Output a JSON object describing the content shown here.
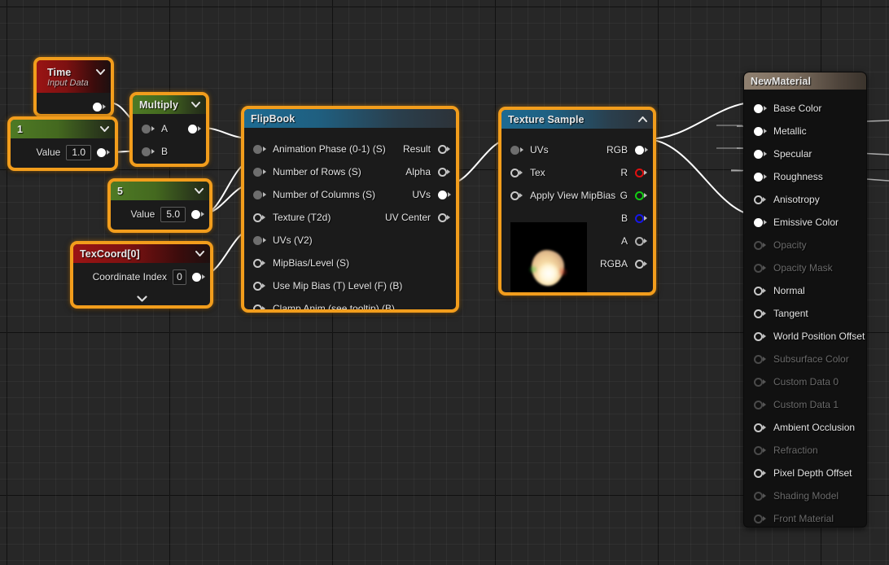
{
  "app": {
    "editor": "Unreal Material Graph"
  },
  "nodes": {
    "time": {
      "title": "Time",
      "subtitle": "Input Data",
      "out_pin": "output"
    },
    "const1": {
      "title": "1",
      "value_label": "Value",
      "value": "1.0"
    },
    "multiply": {
      "title": "Multiply",
      "inputs": [
        "A",
        "B"
      ],
      "output": ""
    },
    "const5": {
      "title": "5",
      "value_label": "Value",
      "value": "5.0"
    },
    "texcoord": {
      "title": "TexCoord[0]",
      "value_label": "Coordinate Index",
      "value": "0"
    },
    "flipbook": {
      "title": "FlipBook",
      "inputs": [
        "Animation  Phase (0-1) (S)",
        "Number of Rows (S)",
        "Number of Columns (S)",
        "Texture (T2d)",
        "UVs (V2)",
        "MipBias/Level (S)",
        "Use Mip Bias (T) Level (F) (B)",
        "Clamp Anim (see tooltip) (B)"
      ],
      "outputs": [
        "Result",
        "Alpha",
        "UVs",
        "UV Center"
      ]
    },
    "texturesample": {
      "title": "Texture Sample",
      "inputs": [
        "UVs",
        "Tex",
        "Apply View MipBias"
      ],
      "outputs": [
        "RGB",
        "R",
        "G",
        "B",
        "A",
        "RGBA"
      ]
    },
    "material": {
      "title": "NewMaterial",
      "inputs": [
        {
          "label": "Base Color",
          "state": "connected"
        },
        {
          "label": "Metallic",
          "state": "connected"
        },
        {
          "label": "Specular",
          "state": "connected"
        },
        {
          "label": "Roughness",
          "state": "connected"
        },
        {
          "label": "Anisotropy",
          "state": "enabled"
        },
        {
          "label": "Emissive Color",
          "state": "connected"
        },
        {
          "label": "Opacity",
          "state": "disabled"
        },
        {
          "label": "Opacity Mask",
          "state": "disabled"
        },
        {
          "label": "Normal",
          "state": "enabled"
        },
        {
          "label": "Tangent",
          "state": "enabled"
        },
        {
          "label": "World Position Offset",
          "state": "enabled"
        },
        {
          "label": "Subsurface Color",
          "state": "disabled"
        },
        {
          "label": "Custom Data 0",
          "state": "disabled"
        },
        {
          "label": "Custom Data 1",
          "state": "disabled"
        },
        {
          "label": "Ambient Occlusion",
          "state": "enabled"
        },
        {
          "label": "Refraction",
          "state": "disabled"
        },
        {
          "label": "Pixel Depth Offset",
          "state": "enabled"
        },
        {
          "label": "Shading Model",
          "state": "disabled"
        },
        {
          "label": "Front Material",
          "state": "disabled"
        }
      ]
    }
  },
  "colors": {
    "selection": "#f29d1c",
    "wire": "#ffffff",
    "header_red": "#9a1414",
    "header_green": "#4e7a25",
    "header_blue": "#1d6b92",
    "header_tan": "#8f8070",
    "pin_r": "#e01010",
    "pin_g": "#13cc13",
    "pin_b": "#1717e8",
    "background": "#272727"
  }
}
